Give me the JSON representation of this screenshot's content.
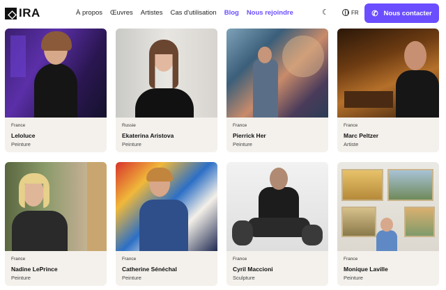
{
  "header": {
    "logo_text": "IRA",
    "nav": [
      {
        "label": "À propos",
        "accent": false
      },
      {
        "label": "Œuvres",
        "accent": false
      },
      {
        "label": "Artistes",
        "accent": false
      },
      {
        "label": "Cas d'utilisation",
        "accent": false
      },
      {
        "label": "Blog",
        "accent": true
      },
      {
        "label": "Nous rejoindre",
        "accent": true
      }
    ],
    "lang": "FR",
    "cta_label": "Nous contacter",
    "accent_color": "#6b4eff"
  },
  "artists": [
    {
      "country": "France",
      "name": "Leloluce",
      "category": "Peinture"
    },
    {
      "country": "Russie",
      "name": "Ekaterina Aristova",
      "category": "Peinture"
    },
    {
      "country": "France",
      "name": "Pierrick Her",
      "category": "Peinture"
    },
    {
      "country": "France",
      "name": "Marc Peltzer",
      "category": "Artiste"
    },
    {
      "country": "France",
      "name": "Nadine LePrince",
      "category": "Peinture"
    },
    {
      "country": "France",
      "name": "Catherine Sénéchal",
      "category": "Peinture"
    },
    {
      "country": "France",
      "name": "Cyril Maccioni",
      "category": "Sculpture"
    },
    {
      "country": "France",
      "name": "Monique Laville",
      "category": "Peinture"
    }
  ]
}
